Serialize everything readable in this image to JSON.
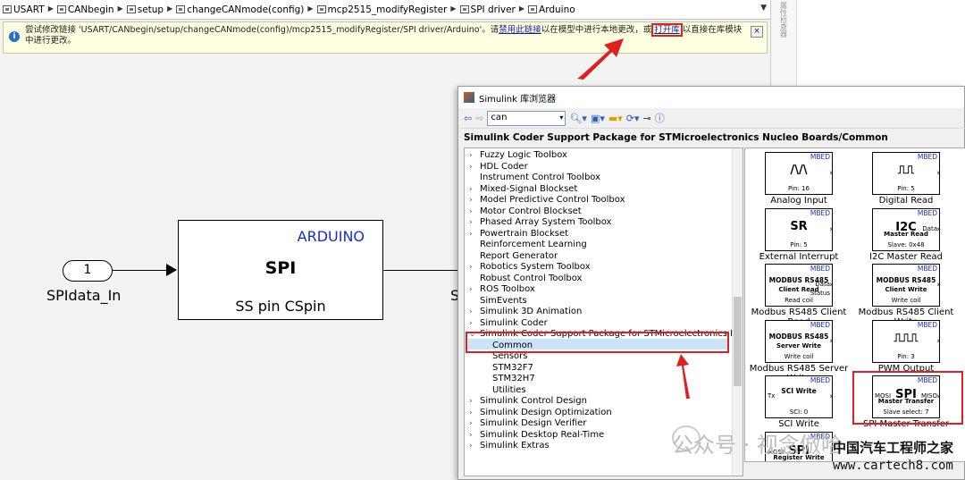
{
  "breadcrumb": {
    "items": [
      "USART",
      "CANbegin",
      "setup",
      "changeCANmode(config)",
      "mcp2515_modifyRegister",
      "SPI driver",
      "Arduino"
    ]
  },
  "notice": {
    "text_prefix": "尝试修改链接 'USART/CANbegin/setup/changeCANmode(config)/mcp2515_modifyRegister/SPI driver/Arduino'。请",
    "link_disable": "禁用此链接",
    "text_mid": "以在模型中进行本地更改，或",
    "link_open": "打开库",
    "text_suffix": "以直接在库模块中进行更改。",
    "close_label": "×"
  },
  "right_strip": {
    "text": "属性检查器"
  },
  "diagram": {
    "inport_number": "1",
    "inport_label": "SPIdata_In",
    "block_top": "ARDUINO",
    "block_center": "SPI",
    "block_bottom": "SS pin CSpin",
    "cut_label": "S"
  },
  "library_browser": {
    "title": "Simulink 库浏览器",
    "search_value": "can",
    "path": "Simulink Coder Support Package for STMicroelectronics Nucleo Boards/Common",
    "tree": [
      {
        "label": "Fuzzy Logic Toolbox",
        "expandable": true
      },
      {
        "label": "HDL Coder",
        "expandable": true
      },
      {
        "label": "Instrument Control Toolbox",
        "expandable": false
      },
      {
        "label": "Mixed-Signal Blockset",
        "expandable": true
      },
      {
        "label": "Model Predictive Control Toolbox",
        "expandable": true
      },
      {
        "label": "Motor Control Blockset",
        "expandable": true
      },
      {
        "label": "Phased Array System Toolbox",
        "expandable": true
      },
      {
        "label": "Powertrain Blockset",
        "expandable": true
      },
      {
        "label": "Reinforcement Learning",
        "expandable": false
      },
      {
        "label": "Report Generator",
        "expandable": false
      },
      {
        "label": "Robotics System Toolbox",
        "expandable": true
      },
      {
        "label": "Robust Control Toolbox",
        "expandable": false
      },
      {
        "label": "ROS Toolbox",
        "expandable": true
      },
      {
        "label": "SimEvents",
        "expandable": false
      },
      {
        "label": "Simulink 3D Animation",
        "expandable": true
      },
      {
        "label": "Simulink Coder",
        "expandable": true
      },
      {
        "label": "Simulink Coder Support Package for STMicroelectronics Nucleo Bo",
        "expandable": true,
        "expanded": true
      },
      {
        "label": "Common",
        "sub": true,
        "selected": true
      },
      {
        "label": "Sensors",
        "sub": true
      },
      {
        "label": "STM32F7",
        "sub": true
      },
      {
        "label": "STM32H7",
        "sub": true
      },
      {
        "label": "Utilities",
        "sub": true
      },
      {
        "label": "Simulink Control Design",
        "expandable": true
      },
      {
        "label": "Simulink Design Optimization",
        "expandable": true
      },
      {
        "label": "Simulink Design Verifier",
        "expandable": true
      },
      {
        "label": "Simulink Desktop Real-Time",
        "expandable": true
      },
      {
        "label": "Simulink Extras",
        "expandable": true
      }
    ],
    "blocks": [
      {
        "name": "Analog Input",
        "tag": "MBED",
        "main": "/\\/\\",
        "sub": "Pin: 16"
      },
      {
        "name": "Digital Read",
        "tag": "MBED",
        "main": "⎍⎍",
        "sub": "Pin: 5"
      },
      {
        "name": "External Interrupt",
        "tag": "MBED",
        "main": "SR",
        "sub": "Pin: 5"
      },
      {
        "name": "I2C Master Read",
        "tag": "MBED",
        "main": "I2C",
        "line2": "Master Read",
        "sub": "Slave: 0x48",
        "port": "Data"
      },
      {
        "name": "Modbus RS485 Client Read",
        "tag": "MBED",
        "main": "MODBUS RS485",
        "line2": "Client Read",
        "sub": "Read coil",
        "port": "Data",
        "port2": "Status"
      },
      {
        "name": "Modbus RS485 Client Write",
        "tag": "MBED",
        "main": "MODBUS RS485",
        "line2": "Client Write",
        "sub": "Write coil"
      },
      {
        "name": "Modbus RS485 Server Write",
        "tag": "MBED",
        "main": "MODBUS RS485",
        "line2": "Server Write",
        "sub": "Write coil"
      },
      {
        "name": "PWM Output",
        "tag": "MBED",
        "main": "⎍⎍⎍",
        "sub": "Pin: 3"
      },
      {
        "name": "SCI Write",
        "tag": "MBED",
        "main": "SCI Write",
        "sub": "SCI: 0",
        "port_in": "Tx"
      },
      {
        "name": "SPI Master Transfer",
        "tag": "MBED",
        "main": "SPI",
        "line2": "Master Transfer",
        "sub": "Slave select: 7",
        "port_in": "MOSI",
        "port": "MISO"
      },
      {
        "name": "",
        "tag": "MBED",
        "main": "SPI",
        "line2": "Register Write",
        "port_in": "MOSI"
      }
    ]
  },
  "watermark": {
    "line1": "公众号 · 视念倣哈",
    "line2": "中国汽车工程师之家",
    "line3": "www.cartech8.com"
  }
}
